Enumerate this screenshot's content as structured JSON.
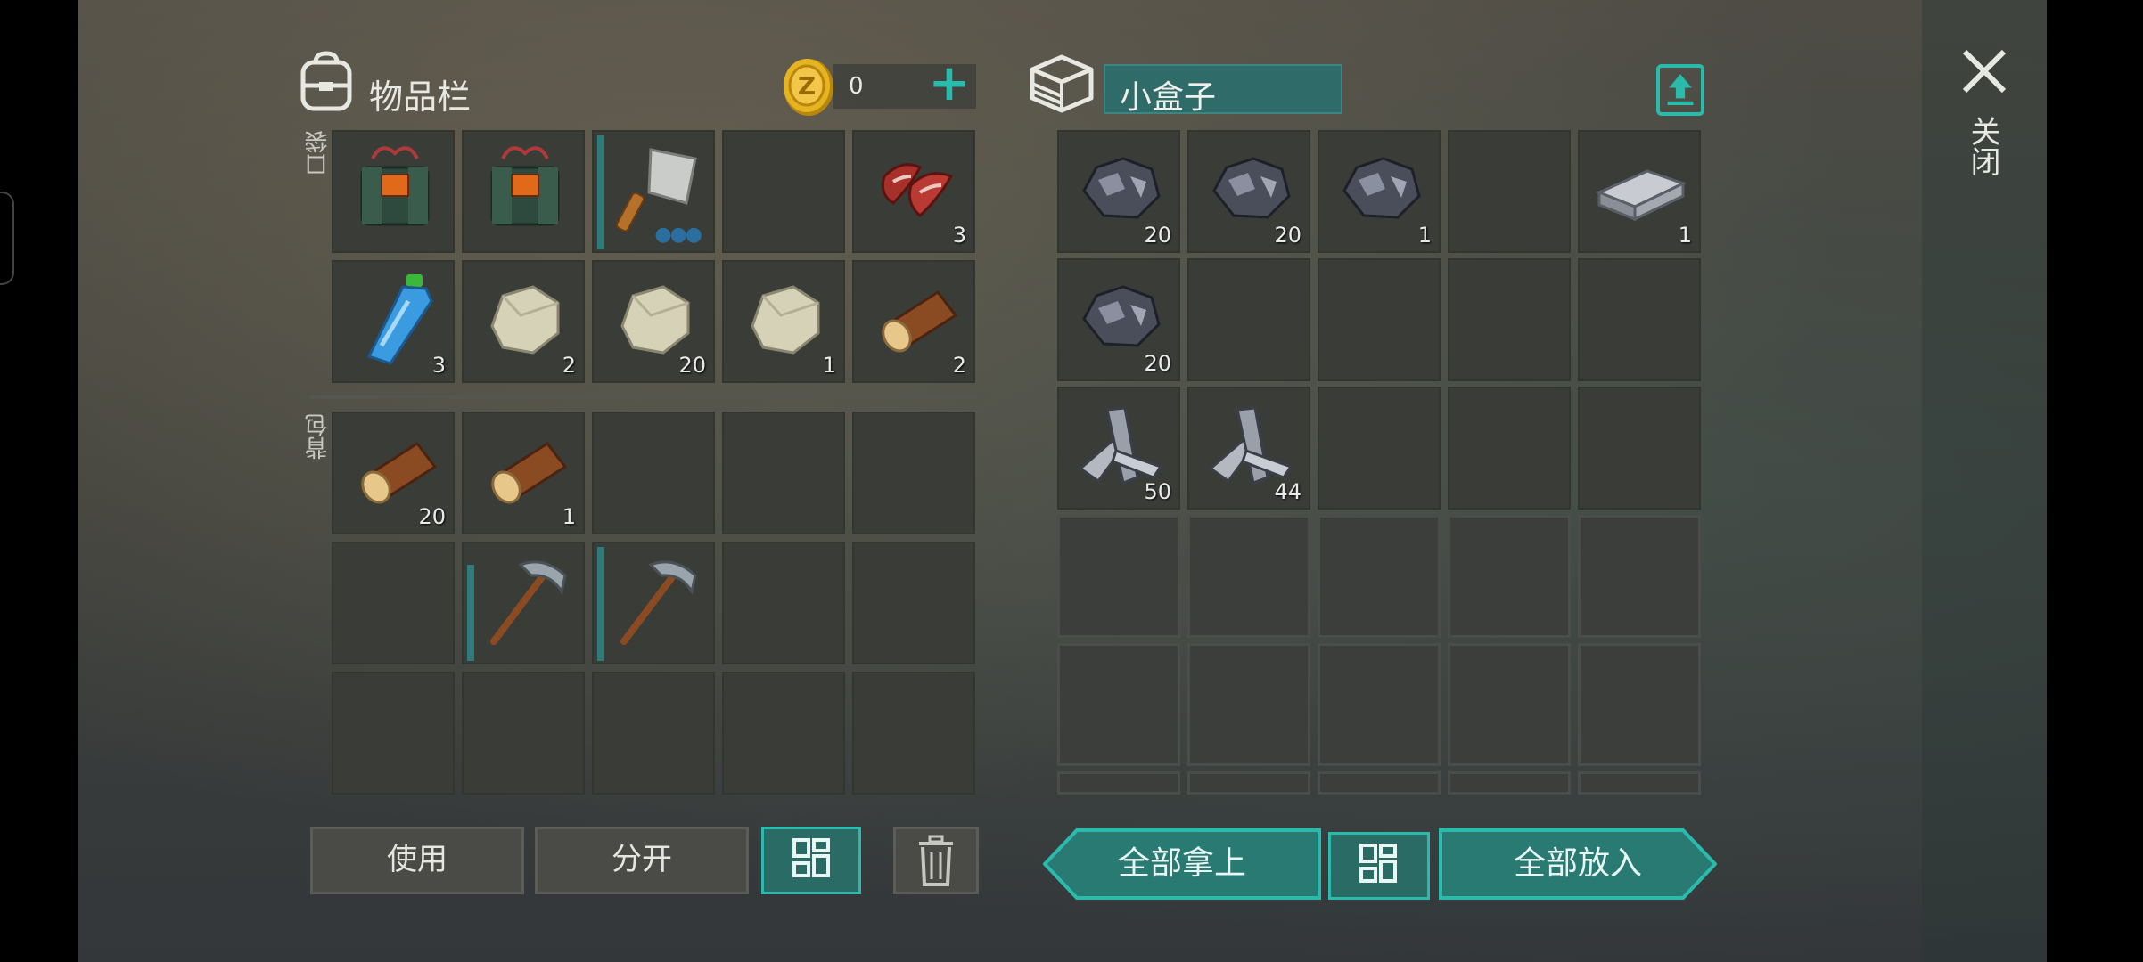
{
  "inventory": {
    "title": "物品栏",
    "coins": "0",
    "pocket_label": "口袋",
    "backpack_label": "背包"
  },
  "container": {
    "name": "小盒子"
  },
  "close_label": "关闭",
  "slots": {
    "p1": {
      "count": ""
    },
    "p2": {
      "count": ""
    },
    "p3": {
      "count": ""
    },
    "p4": {
      "count": ""
    },
    "p5": {
      "count": "3"
    },
    "p6": {
      "count": "3"
    },
    "p7": {
      "count": "2"
    },
    "p8": {
      "count": "20"
    },
    "p9": {
      "count": "1"
    },
    "p10": {
      "count": "2"
    },
    "b1": {
      "count": "20"
    },
    "b2": {
      "count": "1"
    },
    "c1": {
      "count": "20"
    },
    "c2": {
      "count": "20"
    },
    "c3": {
      "count": "1"
    },
    "c5": {
      "count": "1"
    },
    "c6": {
      "count": "20"
    },
    "c11": {
      "count": "50"
    },
    "c12": {
      "count": "44"
    }
  },
  "buttons": {
    "use": "使用",
    "split": "分开",
    "take_all": "全部拿上",
    "put_all": "全部放入"
  },
  "colors": {
    "accent": "#2bbbad",
    "slot_bg": "#3a3c38"
  }
}
